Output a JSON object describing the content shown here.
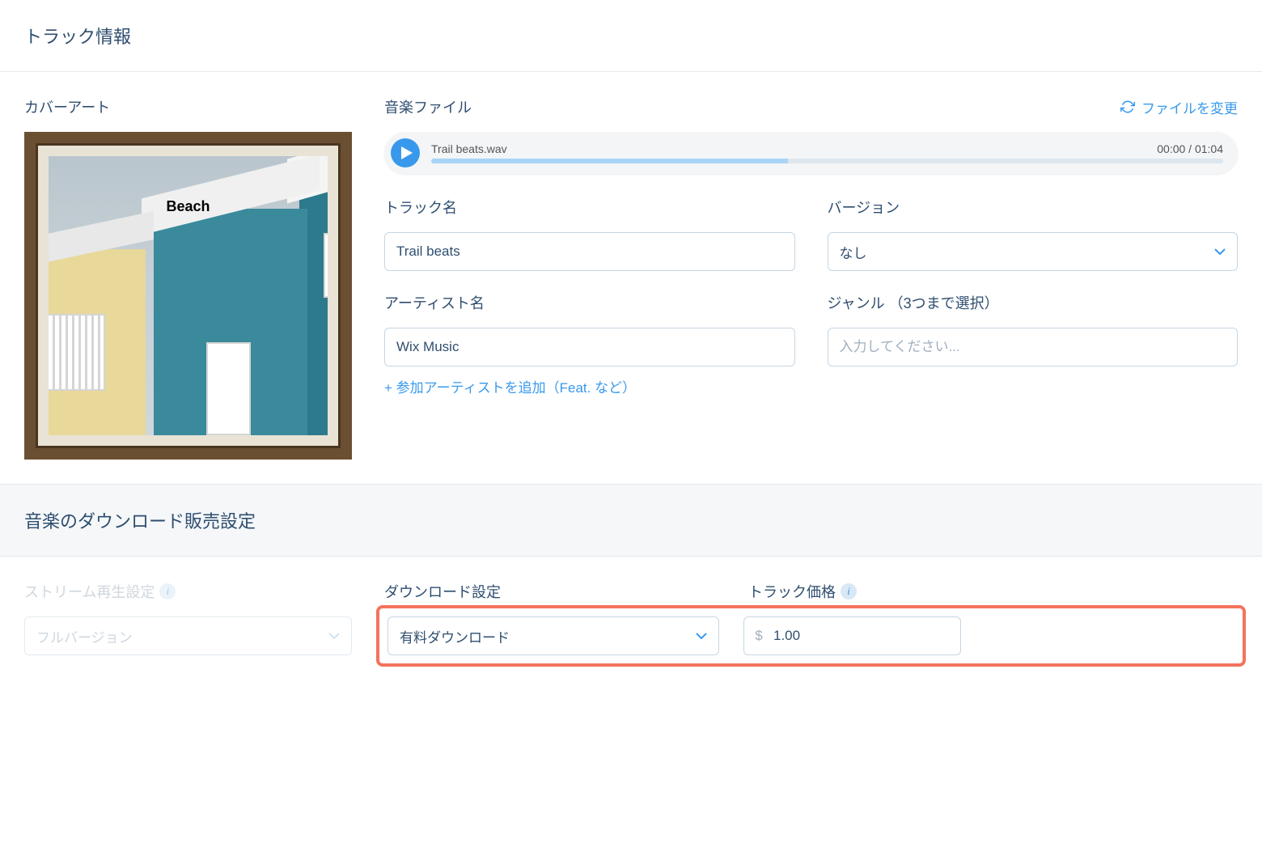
{
  "sections": {
    "track_info_title": "トラック情報",
    "download_sales_title": "音楽のダウンロード販売設定"
  },
  "cover": {
    "label": "カバーアート",
    "album_title": "Beach"
  },
  "music_file": {
    "label": "音楽ファイル",
    "change_label": "ファイルを変更",
    "filename": "Trail beats.wav",
    "time_display": "00:00 / 01:04"
  },
  "fields": {
    "track_name_label": "トラック名",
    "track_name_value": "Trail beats",
    "version_label": "バージョン",
    "version_value": "なし",
    "artist_label": "アーティスト名",
    "artist_value": "Wix Music",
    "add_artist_link": "+ 参加アーティストを追加（Feat. など）",
    "genre_label": "ジャンル （3つまで選択）",
    "genre_placeholder": "入力してください..."
  },
  "download": {
    "stream_label": "ストリーム再生設定",
    "stream_value": "フルバージョン",
    "download_label": "ダウンロード設定",
    "download_value": "有料ダウンロード",
    "price_label": "トラック価格",
    "price_currency": "$",
    "price_value": "1.00"
  }
}
